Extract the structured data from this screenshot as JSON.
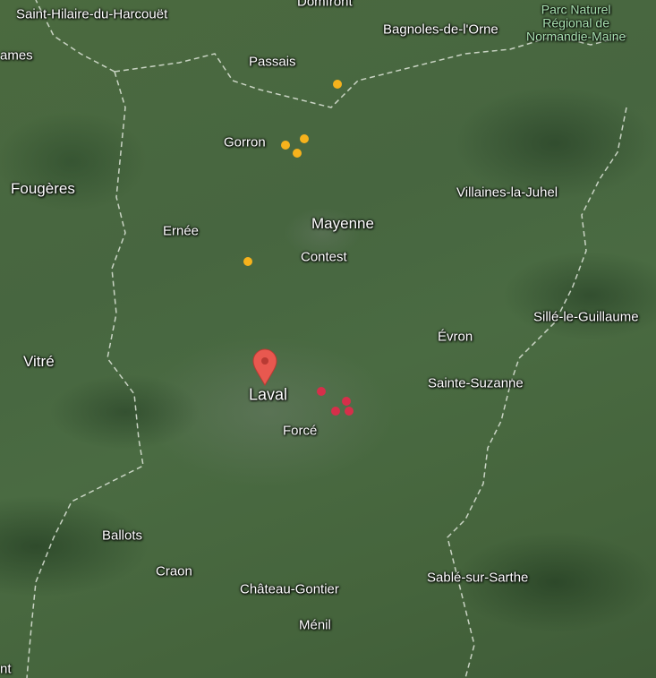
{
  "labels": {
    "saint_hilaire": "Saint-Hilaire-du-Harcouët",
    "domfront": "Domfront",
    "bagnoles": "Bagnoles-de-l'Orne",
    "park_line1": "Parc Naturel",
    "park_line2": "Régional de",
    "park_line3": "Normandie-Maine",
    "james": "ames",
    "passais": "Passais",
    "gorron": "Gorron",
    "fougeres": "Fougères",
    "villaines": "Villaines-la-Juhel",
    "ernee": "Ernée",
    "mayenne": "Mayenne",
    "contest": "Contest",
    "sille": "Sillé-le-Guillaume",
    "evron": "Évron",
    "vitre": "Vitré",
    "sainte_suzanne": "Sainte-Suzanne",
    "laval": "Laval",
    "force": "Forcé",
    "ballots": "Ballots",
    "craon": "Craon",
    "sable": "Sablé-sur-Sarthe",
    "chateau_gontier": "Château-Gontier",
    "menil": "Ménil",
    "edge_nt": "nt"
  },
  "markers": {
    "pin_color": "#e8584f",
    "orange_color": "#f6b21c",
    "red_color": "#d62f4a"
  }
}
